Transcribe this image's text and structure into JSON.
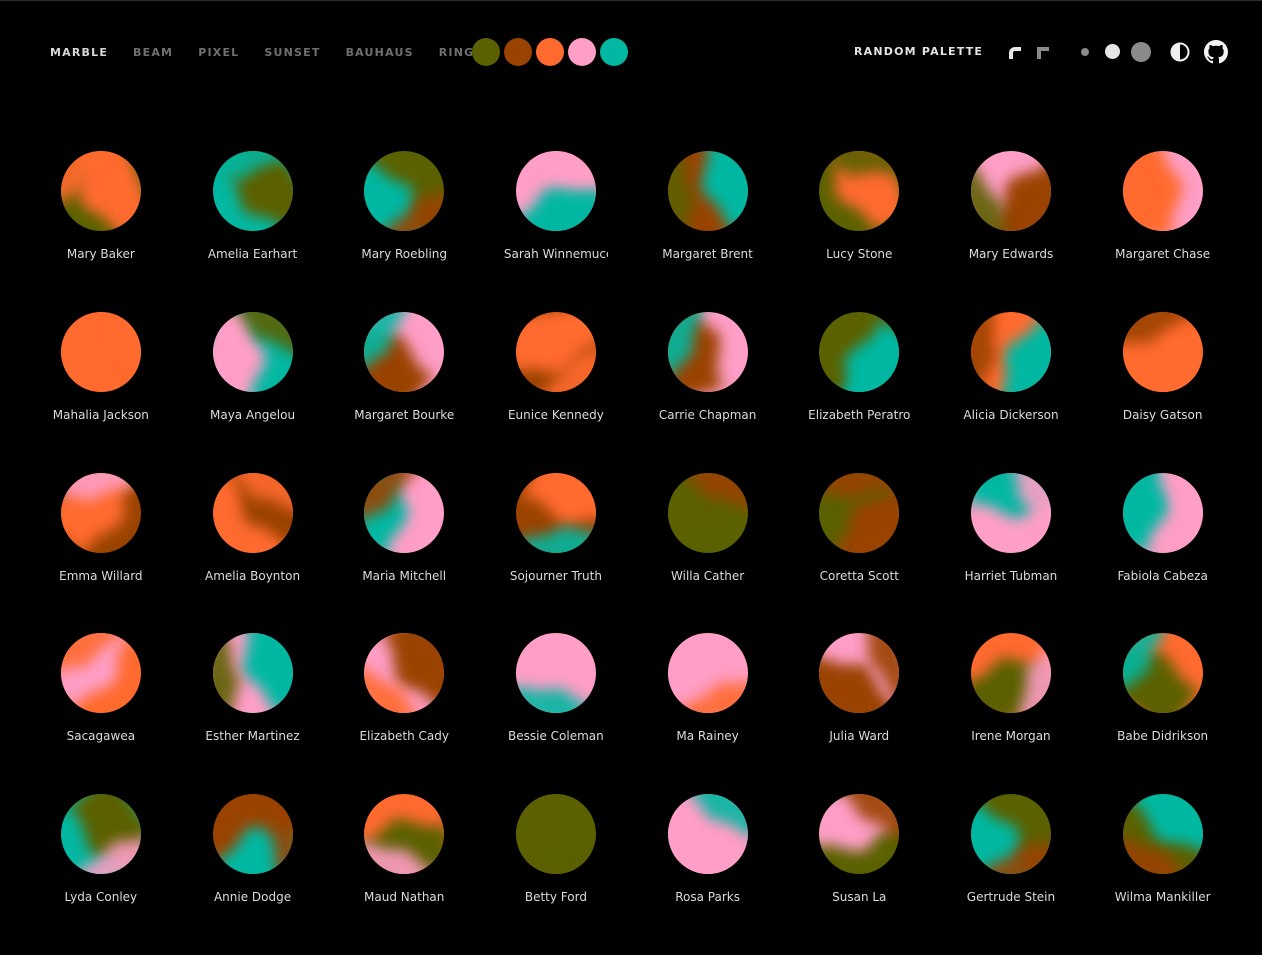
{
  "nav": {
    "items": [
      {
        "label": "MARBLE",
        "active": true
      },
      {
        "label": "BEAM",
        "active": false
      },
      {
        "label": "PIXEL",
        "active": false
      },
      {
        "label": "SUNSET",
        "active": false
      },
      {
        "label": "BAUHAUS",
        "active": false
      },
      {
        "label": "RING",
        "active": false
      }
    ]
  },
  "palette": {
    "colors": [
      "#5b6100",
      "#9a4300",
      "#ff6a2e",
      "#ff9ec6",
      "#02b8a2"
    ]
  },
  "controls": {
    "random_palette_label": "RANDOM PALETTE",
    "icons": [
      "round-corner-icon",
      "square-corner-icon",
      "size-small-icon",
      "size-medium-icon",
      "size-large-icon",
      "theme-toggle-icon",
      "github-icon"
    ]
  },
  "avatars": [
    {
      "name": "Mary Baker"
    },
    {
      "name": "Amelia Earhart"
    },
    {
      "name": "Mary Roebling"
    },
    {
      "name": "Sarah Winnemucc"
    },
    {
      "name": "Margaret Brent"
    },
    {
      "name": "Lucy Stone"
    },
    {
      "name": "Mary Edwards"
    },
    {
      "name": "Margaret Chase"
    },
    {
      "name": "Mahalia Jackson"
    },
    {
      "name": "Maya Angelou"
    },
    {
      "name": "Margaret Bourke"
    },
    {
      "name": "Eunice Kennedy"
    },
    {
      "name": "Carrie Chapman"
    },
    {
      "name": "Elizabeth Peratro"
    },
    {
      "name": "Alicia Dickerson"
    },
    {
      "name": "Daisy Gatson"
    },
    {
      "name": "Emma Willard"
    },
    {
      "name": "Amelia Boynton"
    },
    {
      "name": "Maria Mitchell"
    },
    {
      "name": "Sojourner Truth"
    },
    {
      "name": "Willa Cather"
    },
    {
      "name": "Coretta Scott"
    },
    {
      "name": "Harriet Tubman"
    },
    {
      "name": "Fabiola Cabeza"
    },
    {
      "name": "Sacagawea"
    },
    {
      "name": "Esther Martinez"
    },
    {
      "name": "Elizabeth Cady"
    },
    {
      "name": "Bessie Coleman"
    },
    {
      "name": "Ma Rainey"
    },
    {
      "name": "Julia Ward"
    },
    {
      "name": "Irene Morgan"
    },
    {
      "name": "Babe Didrikson"
    },
    {
      "name": "Lyda Conley"
    },
    {
      "name": "Annie Dodge"
    },
    {
      "name": "Maud Nathan"
    },
    {
      "name": "Betty Ford"
    },
    {
      "name": "Rosa Parks"
    },
    {
      "name": "Susan La"
    },
    {
      "name": "Gertrude Stein"
    },
    {
      "name": "Wilma Mankiller"
    }
  ]
}
